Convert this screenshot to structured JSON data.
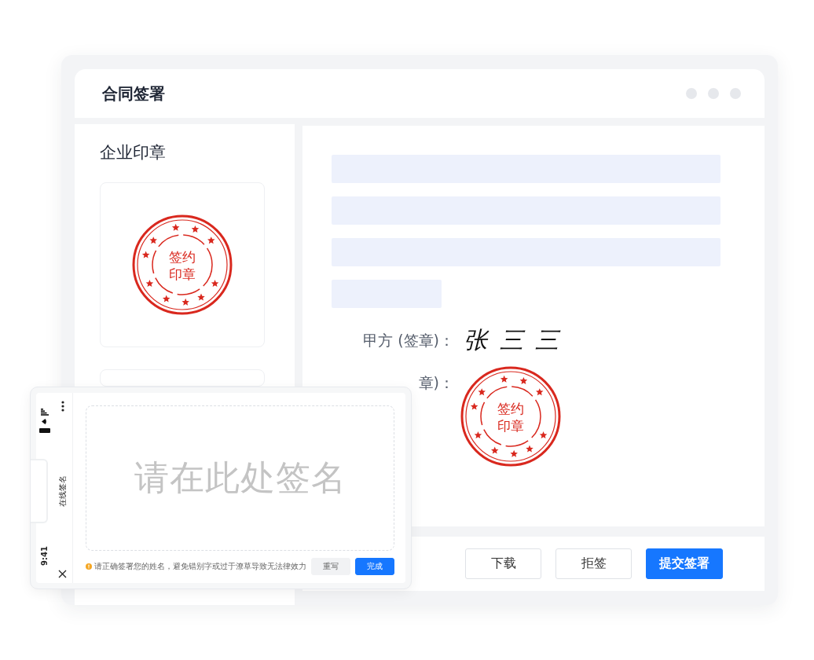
{
  "window": {
    "title": "合同签署"
  },
  "seal_panel": {
    "title": "企业印章",
    "cards": [
      {
        "kind": "seal",
        "lines": [
          "签约",
          "印章"
        ]
      },
      {
        "kind": "empty"
      }
    ]
  },
  "signatures": [
    {
      "kind": "handwriting",
      "label": "甲方 (签章)：",
      "value": "张 三 三"
    },
    {
      "kind": "seal",
      "label": "章)：",
      "lines": [
        "签约",
        "印章"
      ]
    }
  ],
  "actions": [
    {
      "label": "下载",
      "kind": "default"
    },
    {
      "label": "拒签",
      "kind": "default"
    },
    {
      "label": "提交签署",
      "kind": "primary"
    }
  ],
  "mobile": {
    "time": "9:41",
    "title": "在线签名",
    "pad": {
      "placeholder": "请在此处签名"
    },
    "tip": "请正确签署您的姓名，避免错别字或过于潦草导致无法律效力",
    "buttons": [
      {
        "label": "重写",
        "kind": "default"
      },
      {
        "label": "完成",
        "kind": "primary"
      }
    ]
  }
}
